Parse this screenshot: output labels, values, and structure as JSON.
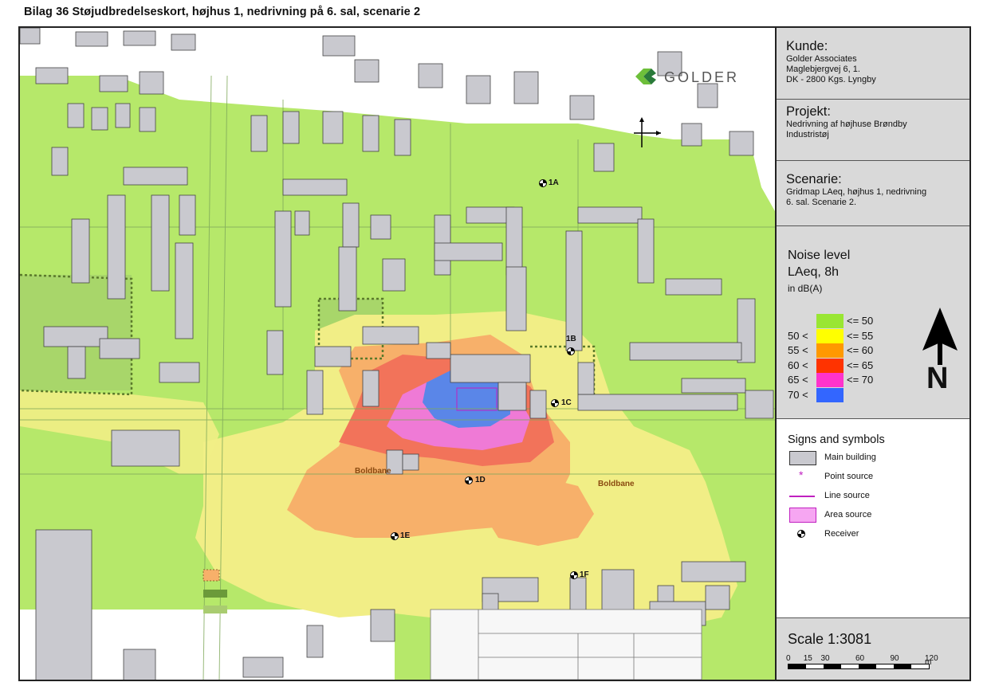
{
  "title": "Bilag 36  Støjudbredelseskort, højhus 1, nedrivning på 6. sal, scenarie 2",
  "customer": {
    "heading": "Kunde:",
    "lines": [
      "Golder Associates",
      "Maglebjergvej 6, 1.",
      "DK - 2800 Kgs. Lyngby"
    ]
  },
  "project": {
    "heading": "Projekt:",
    "lines": [
      "Nedrivning af højhuse Brøndby",
      "Industristøj"
    ]
  },
  "scenario": {
    "heading": "Scenarie:",
    "lines": [
      "Gridmap LAeq, højhus 1, nedrivning",
      "6. sal. Scenarie 2."
    ]
  },
  "logo_text": "GOLDER",
  "noise_legend": {
    "heading1": "Noise level",
    "heading2": "LAeq, 8h",
    "heading3": "in dB(A)",
    "items": [
      {
        "low": "",
        "high": "<= 50",
        "color": "#99e633"
      },
      {
        "low": "50 <",
        "high": "<= 55",
        "color": "#ffff00"
      },
      {
        "low": "55 <",
        "high": "<= 60",
        "color": "#ff9900"
      },
      {
        "low": "60 <",
        "high": "<= 65",
        "color": "#ff3300"
      },
      {
        "low": "65 <",
        "high": "<= 70",
        "color": "#ff33cc"
      },
      {
        "low": "70 <",
        "high": "",
        "color": "#3366ff"
      }
    ]
  },
  "north_label": "N",
  "signs": {
    "heading": "Signs and symbols",
    "items": [
      {
        "label": "Main building"
      },
      {
        "label": "Point source"
      },
      {
        "label": "Line source"
      },
      {
        "label": "Area source"
      },
      {
        "label": "Receiver"
      }
    ]
  },
  "scale": {
    "title": "Scale 1:3081",
    "ticks": [
      "0",
      "15",
      "30",
      "60",
      "90",
      "120"
    ],
    "unit": "m"
  },
  "receivers": [
    {
      "id": "1A"
    },
    {
      "id": "1B"
    },
    {
      "id": "1C"
    },
    {
      "id": "1D"
    },
    {
      "id": "1E"
    },
    {
      "id": "1F"
    }
  ],
  "map_labels": {
    "boldbane_1": "Boldbane",
    "boldbane_2": "Boldbane"
  },
  "colors": {
    "zone50": "#b6e86a",
    "zone55": "#f1ee86",
    "zone60": "#f7b06a",
    "zone65": "#f2735a",
    "zone70": "#ef7ad6",
    "zoneMax": "#5a86e8",
    "building": "#c9c9cf"
  }
}
